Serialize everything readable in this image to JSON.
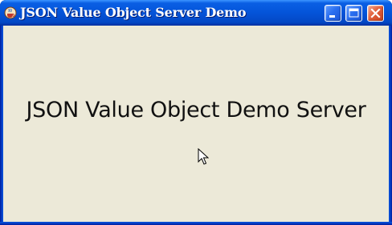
{
  "window": {
    "title": "JSON Value Object Server Demo",
    "icon": "java-cup-icon",
    "controls": [
      "minimize-icon",
      "maximize-icon",
      "close-icon"
    ]
  },
  "content": {
    "label": "JSON Value Object Demo Server"
  },
  "colors": {
    "titlebar": "#0454d9",
    "client_background": "#ece9d8",
    "close_button": "#e2603c",
    "text": "#111111"
  }
}
